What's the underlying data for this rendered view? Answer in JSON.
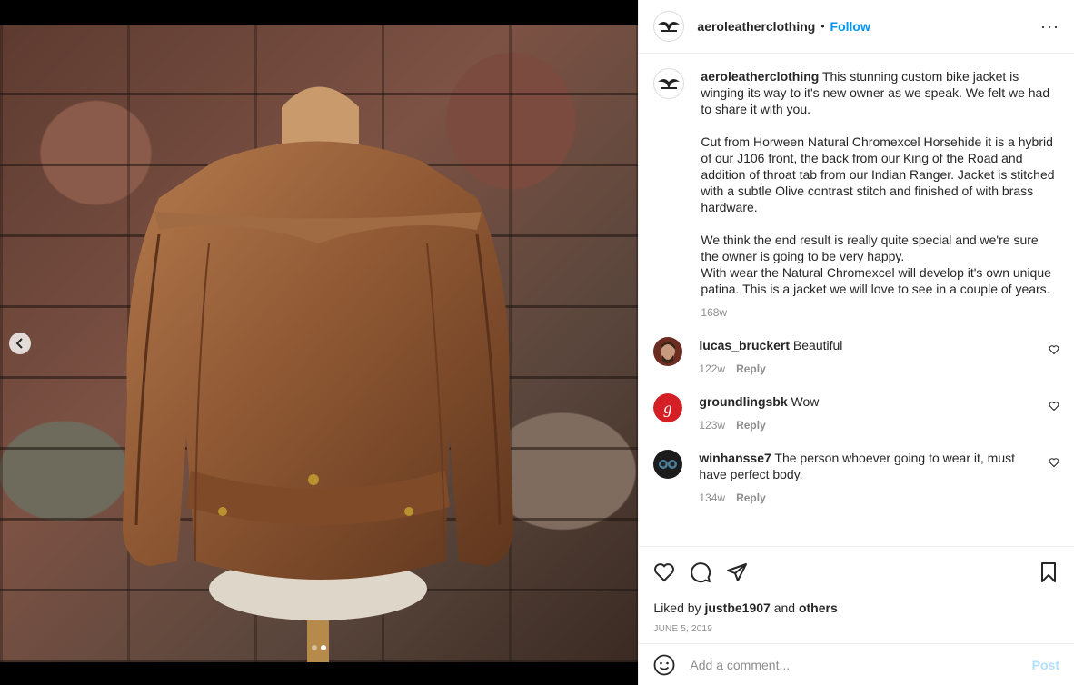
{
  "post": {
    "username": "aeroleatherclothing",
    "follow_label": "Follow",
    "separator": "•",
    "more_label": "···"
  },
  "caption": {
    "username": "aeroleatherclothing",
    "paragraphs": [
      "This stunning custom bike jacket is winging its way to it's new owner as we speak. We felt we had to share it with you.",
      "Cut from Horween Natural Chromexcel Horsehide it is a hybrid of our J106 front, the back from our King of the Road and addition of throat tab from our Indian Ranger. Jacket is stitched with a subtle Olive contrast stitch and finished of with brass hardware.",
      "We think the end result is really quite special and we're sure the owner is going to be very happy.\nWith wear the Natural Chromexcel will develop it's own unique patina. This is a jacket we will love to see in a couple of years."
    ],
    "time": "168w"
  },
  "comments": [
    {
      "username": "lucas_bruckert",
      "text": "Beautiful",
      "time": "122w",
      "reply": "Reply",
      "avatar_color": "#8a3b2b"
    },
    {
      "username": "groundlingsbk",
      "text": "Wow",
      "time": "123w",
      "reply": "Reply",
      "avatar_color": "#d41f26"
    },
    {
      "username": "winhansse7",
      "text": "The person whoever going to wear it, must have perfect body.",
      "time": "134w",
      "reply": "Reply",
      "avatar_color": "#1c1c1c"
    }
  ],
  "likes": {
    "prefix": "Liked by",
    "user": "justbe1907",
    "and": "and",
    "others": "others"
  },
  "date": "JUNE 5, 2019",
  "add_comment": {
    "placeholder": "Add a comment...",
    "post_label": "Post"
  },
  "carousel": {
    "total": 2,
    "active": 2
  },
  "colors": {
    "accent": "#0095f6",
    "muted": "#8e8e8e",
    "text": "#262626",
    "post_disabled": "#b2dffc"
  }
}
